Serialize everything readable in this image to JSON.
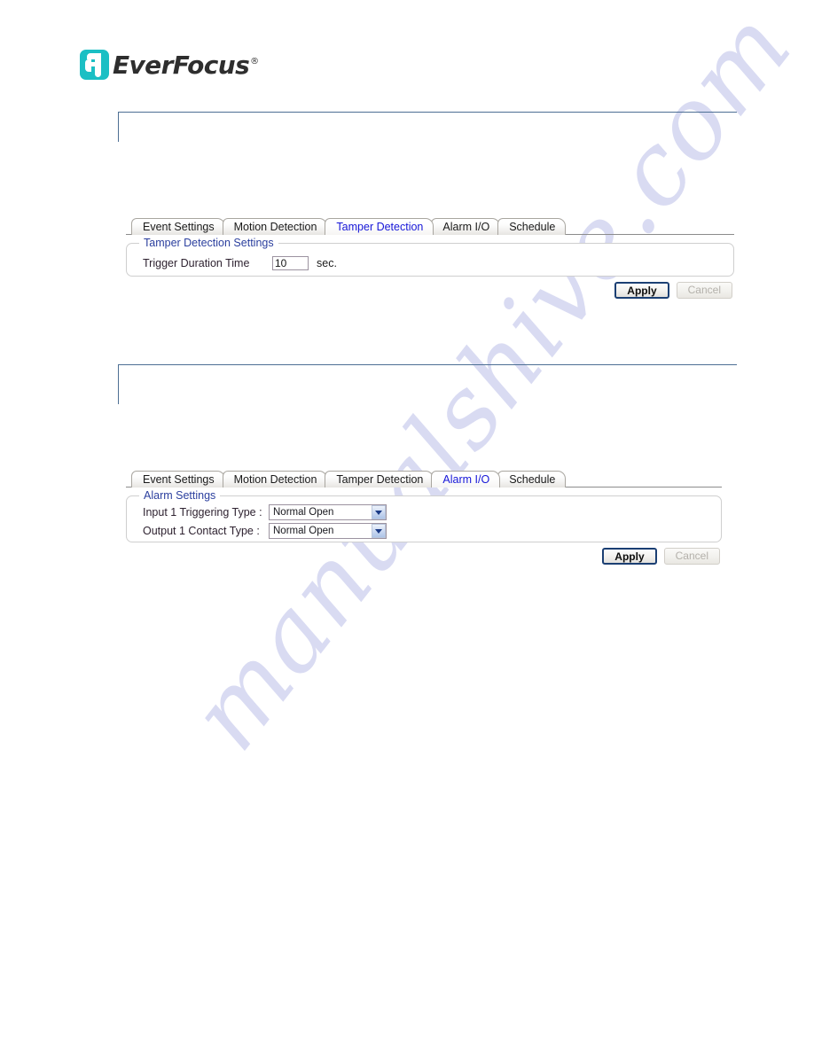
{
  "brand": {
    "name": "EverFocus",
    "registered_mark": "®",
    "logo_color": "#1bbfc4",
    "wordmark_color": "#2e2e2e"
  },
  "watermark": {
    "text": "manualshive.com",
    "color": "#c9cced"
  },
  "sections": [
    {
      "id": "tamper-detection",
      "caption": "",
      "tabs": [
        {
          "label": "Event Settings",
          "active": false
        },
        {
          "label": "Motion Detection",
          "active": false
        },
        {
          "label": "Tamper Detection",
          "active": true
        },
        {
          "label": "Alarm I/O",
          "active": false
        },
        {
          "label": "Schedule",
          "active": false
        }
      ],
      "panel": {
        "legend": "Tamper Detection Settings",
        "legend_color": "#2b3f9e",
        "fields": [
          {
            "label": "Trigger Duration Time",
            "type": "text",
            "value": "10",
            "unit": "sec."
          }
        ]
      },
      "buttons": {
        "apply": "Apply",
        "cancel": "Cancel",
        "apply_focused": true,
        "cancel_disabled": true
      }
    },
    {
      "id": "alarm-io",
      "caption": "",
      "tabs": [
        {
          "label": "Event Settings",
          "active": false
        },
        {
          "label": "Motion Detection",
          "active": false
        },
        {
          "label": "Tamper Detection",
          "active": false
        },
        {
          "label": "Alarm I/O",
          "active": true
        },
        {
          "label": "Schedule",
          "active": false
        }
      ],
      "panel": {
        "legend": "Alarm Settings",
        "legend_color": "#2b3f9e",
        "fields": [
          {
            "label": "Input 1 Triggering Type :",
            "type": "select",
            "value": "Normal Open"
          },
          {
            "label": "Output 1 Contact Type :",
            "type": "select",
            "value": "Normal Open"
          }
        ]
      },
      "buttons": {
        "apply": "Apply",
        "cancel": "Cancel",
        "apply_focused": true,
        "cancel_disabled": true
      }
    }
  ]
}
